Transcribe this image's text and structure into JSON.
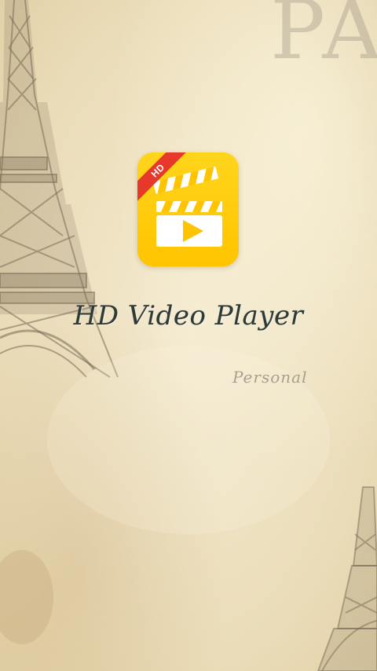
{
  "splash": {
    "watermark_text": "PA",
    "icon": {
      "name": "clapperboard-play-icon",
      "badge": "HD",
      "color": "#ffc400",
      "badge_color": "#e8372b"
    },
    "title": "HD Video Player",
    "subtitle": "Personal"
  }
}
